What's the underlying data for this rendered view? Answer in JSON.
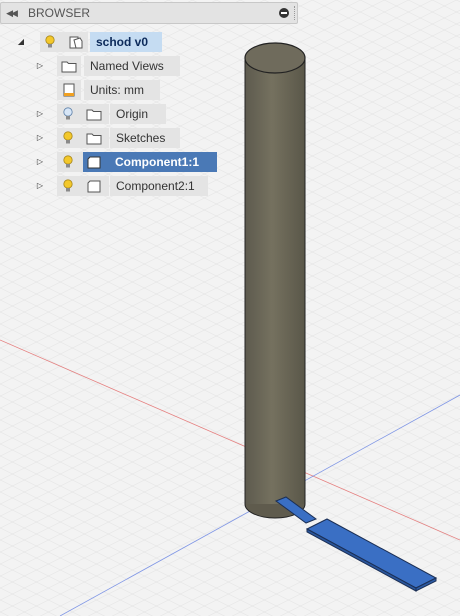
{
  "panel": {
    "title": "BROWSER",
    "collapse_icon": "double-left-arrow-icon",
    "minimize_icon": "minus-circle-icon"
  },
  "tree": {
    "root": {
      "label": "schod v0",
      "expanded": true,
      "state": "active"
    },
    "items": [
      {
        "label": "Named Views",
        "icon": "folder-icon",
        "has_bulb": false
      },
      {
        "label": "Units: mm",
        "icon": "ruler-icon",
        "has_bulb": false
      },
      {
        "label": "Origin",
        "icon": "folder-icon",
        "has_bulb": true,
        "bulb": "off"
      },
      {
        "label": "Sketches",
        "icon": "folder-icon",
        "has_bulb": true,
        "bulb": "on"
      },
      {
        "label": "Component1:1",
        "icon": "component-icon",
        "has_bulb": true,
        "bulb": "on",
        "selected": true
      },
      {
        "label": "Component2:1",
        "icon": "component-icon",
        "has_bulb": true,
        "bulb": "on"
      }
    ]
  },
  "colors": {
    "selection": "#4a79b6",
    "active_highlight": "#c5dcf2",
    "cylinder": "#6b6758",
    "plate": "#3a6fc4",
    "x_axis": "#e05050",
    "y_axis": "#5070e0"
  }
}
